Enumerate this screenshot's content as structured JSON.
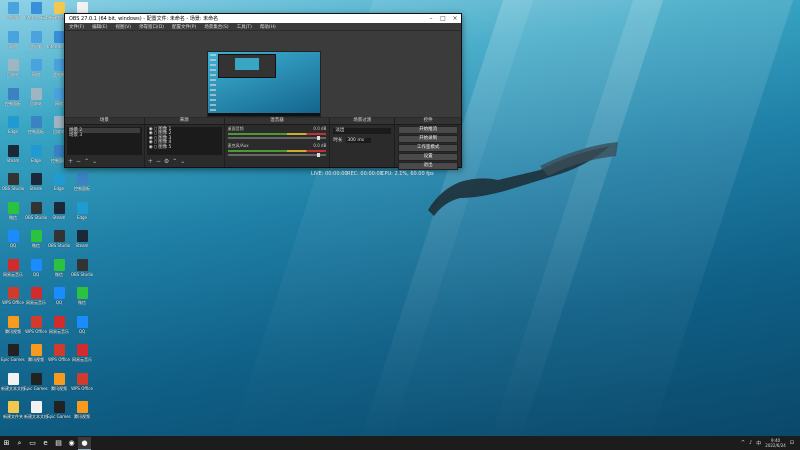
{
  "desktop": {
    "icons": [
      {
        "label": "此电脑",
        "color": "#4aa3df"
      },
      {
        "label": "网络",
        "color": "#4aa3df"
      },
      {
        "label": "回收站",
        "color": "#9fb5c2"
      },
      {
        "label": "控制面板",
        "color": "#3b82c4"
      },
      {
        "label": "Edge",
        "color": "#1f9bd1"
      },
      {
        "label": "Steam",
        "color": "#1b2838"
      },
      {
        "label": "OBS Studio",
        "color": "#333333"
      },
      {
        "label": "微信",
        "color": "#2ac23f"
      },
      {
        "label": "QQ",
        "color": "#1a8cff"
      },
      {
        "label": "网易云音乐",
        "color": "#d22b2b"
      },
      {
        "label": "WPS Office",
        "color": "#d13b2b"
      },
      {
        "label": "腾讯视频",
        "color": "#f79a1e"
      },
      {
        "label": "Epic Games Launcher",
        "color": "#222222"
      },
      {
        "label": "新建文本文档",
        "color": "#f2f2f2"
      },
      {
        "label": "新建文件夹",
        "color": "#f2c94c"
      },
      {
        "label": "Internet Explorer",
        "color": "#3a8fd9"
      }
    ]
  },
  "obs": {
    "title": "OBS 27.0.1 (64 bit, windows) - 配置文件: 未命名 - 场景: 未命名",
    "menu": [
      "文件(F)",
      "编辑(E)",
      "视图(V)",
      "停靠窗口(D)",
      "配置文件(P)",
      "场景集合(S)",
      "工具(T)",
      "帮助(H)"
    ],
    "docks": {
      "scenes": {
        "header": "场景",
        "items": [
          "场景 2",
          "场景 3"
        ]
      },
      "sources": {
        "header": "来源",
        "items": [
          "图像 1",
          "图像 2",
          "图像 3",
          "图像 4",
          "图像 5"
        ]
      },
      "mixer": {
        "header": "混音器",
        "channels": [
          {
            "name": "桌面音频",
            "db": "0.0 dB"
          },
          {
            "name": "麦克风/Aux",
            "db": "0.0 dB"
          }
        ]
      },
      "transitions": {
        "header": "场景过渡",
        "selected": "淡出",
        "duration_label": "时长",
        "duration": "300 ms"
      },
      "controls": {
        "header": "控件",
        "buttons": [
          "开始推流",
          "开始录制",
          "工作室模式",
          "设置",
          "退出"
        ]
      }
    },
    "status": {
      "live": "LIVE: 00:00:00",
      "rec": "REC: 00:00:00",
      "cpu": "CPU: 2.1%, 60.00 fps"
    }
  },
  "taskbar": {
    "items": [
      "⊞",
      "⌕",
      "▭",
      "e",
      "▤",
      "◉",
      "●"
    ],
    "tray": [
      "^",
      "♪",
      "中",
      "⊡"
    ],
    "time": "9:40",
    "date": "2022/6/24"
  }
}
